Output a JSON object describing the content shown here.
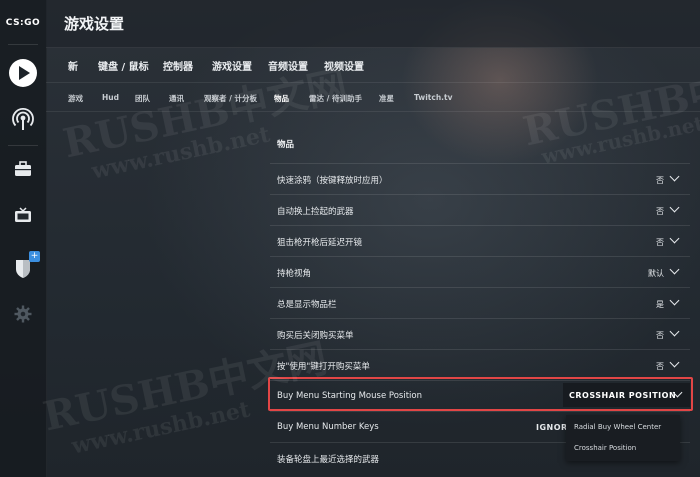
{
  "sidebar": {
    "logo": "CS:GO",
    "items": [
      {
        "icon": "play-icon"
      },
      {
        "icon": "broadcast-icon"
      },
      {
        "icon": "briefcase-icon"
      },
      {
        "icon": "tv-icon"
      },
      {
        "icon": "shield-icon",
        "badge": "+"
      },
      {
        "icon": "gear-icon"
      }
    ]
  },
  "header": {
    "title": "游戏设置"
  },
  "main_tabs": [
    "新",
    "键盘 / 鼠标",
    "控制器",
    "游戏设置",
    "音频设置",
    "视频设置"
  ],
  "sub_tabs": [
    "游戏",
    "Hud",
    "团队",
    "通讯",
    "观察者 / 计分板",
    "物品",
    "雷达 / 待训助手",
    "准星",
    "Twitch.tv"
  ],
  "active_sub_tab": "物品",
  "section": {
    "title": "物品",
    "rows": [
      {
        "label": "快速涂鸦（按键释放时应用）",
        "value": "否"
      },
      {
        "label": "自动换上捡起的武器",
        "value": "否"
      },
      {
        "label": "狙击枪开枪后延迟开镜",
        "value": "否"
      },
      {
        "label": "持枪视角",
        "value": "默认"
      },
      {
        "label": "总是显示物品栏",
        "value": "是"
      },
      {
        "label": "购买后关闭购买菜单",
        "value": "否"
      },
      {
        "label": "按\"使用\"键打开购买菜单",
        "value": "否"
      },
      {
        "label": "Buy Menu Starting Mouse Position",
        "value": "CROSSHAIR POSITION"
      },
      {
        "label": "Buy Menu Number Keys",
        "value": "IGNOR"
      },
      {
        "label": "装备轮盘上最近选择的武器",
        "value": ""
      }
    ]
  },
  "dropdown": {
    "options": [
      "Radial Buy Wheel Center",
      "Crosshair Position"
    ]
  },
  "watermark": {
    "brand": "RUSHB中文网",
    "url": "www.rushb.net"
  },
  "colors": {
    "highlight": "#e24646",
    "badge": "#3b8fe0"
  }
}
